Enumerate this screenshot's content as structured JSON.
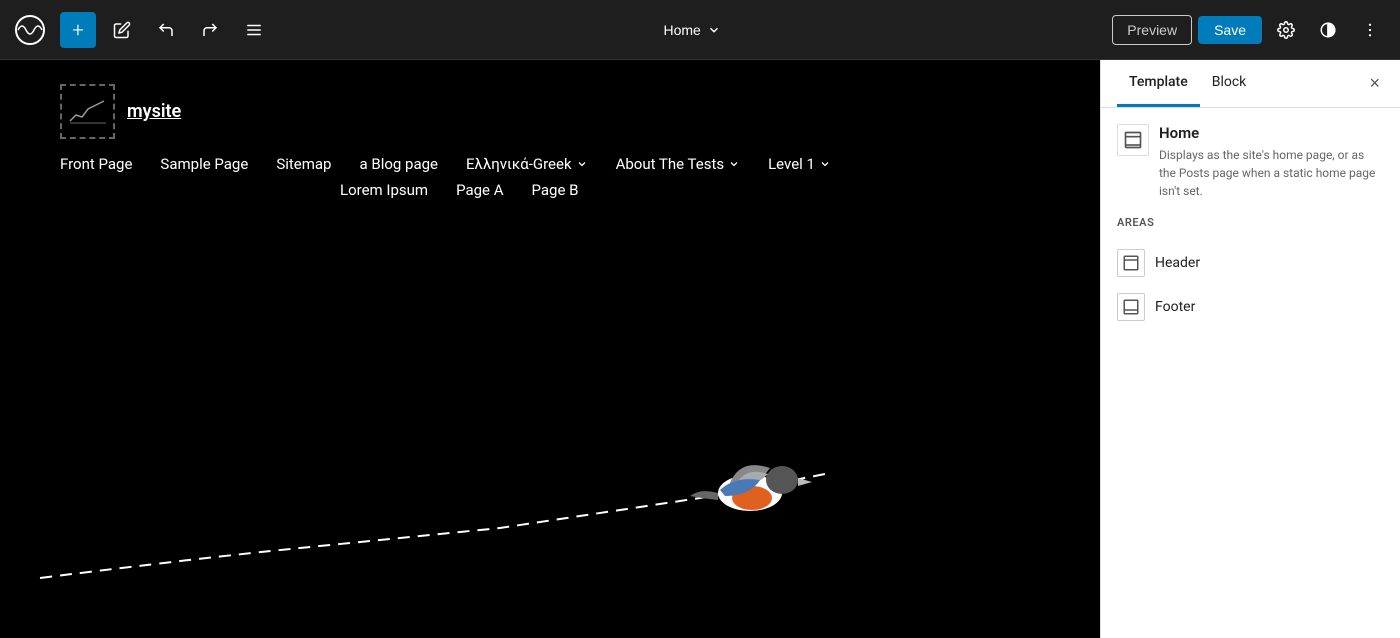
{
  "toolbar": {
    "add_label": "+",
    "edit_icon": "✏",
    "undo_icon": "↩",
    "redo_icon": "↪",
    "menu_icon": "≡",
    "page_selector": "Home",
    "page_chevron": "∨",
    "preview_label": "Preview",
    "save_label": "Save",
    "settings_icon": "⚙",
    "contrast_icon": "◑",
    "more_icon": "⋮"
  },
  "panel": {
    "tab_template": "Template",
    "tab_block": "Block",
    "close_icon": "×",
    "home_title": "Home",
    "home_description": "Displays as the site's home page, or as the Posts page when a static home page isn't set.",
    "areas_label": "AREAS",
    "areas": [
      {
        "label": "Header"
      },
      {
        "label": "Footer"
      }
    ]
  },
  "canvas": {
    "site_name": "mysite",
    "nav_row1": [
      "Front Page",
      "Sample Page",
      "Sitemap",
      "a Blog page",
      "Ελληνικά-Greek",
      "About The Tests",
      "Level 1"
    ],
    "nav_row2": [
      "Lorem Ipsum",
      "Page A",
      "Page B"
    ],
    "nav_chevron_items": [
      "Ελληνικά-Greek",
      "About The Tests",
      "Level 1"
    ]
  }
}
